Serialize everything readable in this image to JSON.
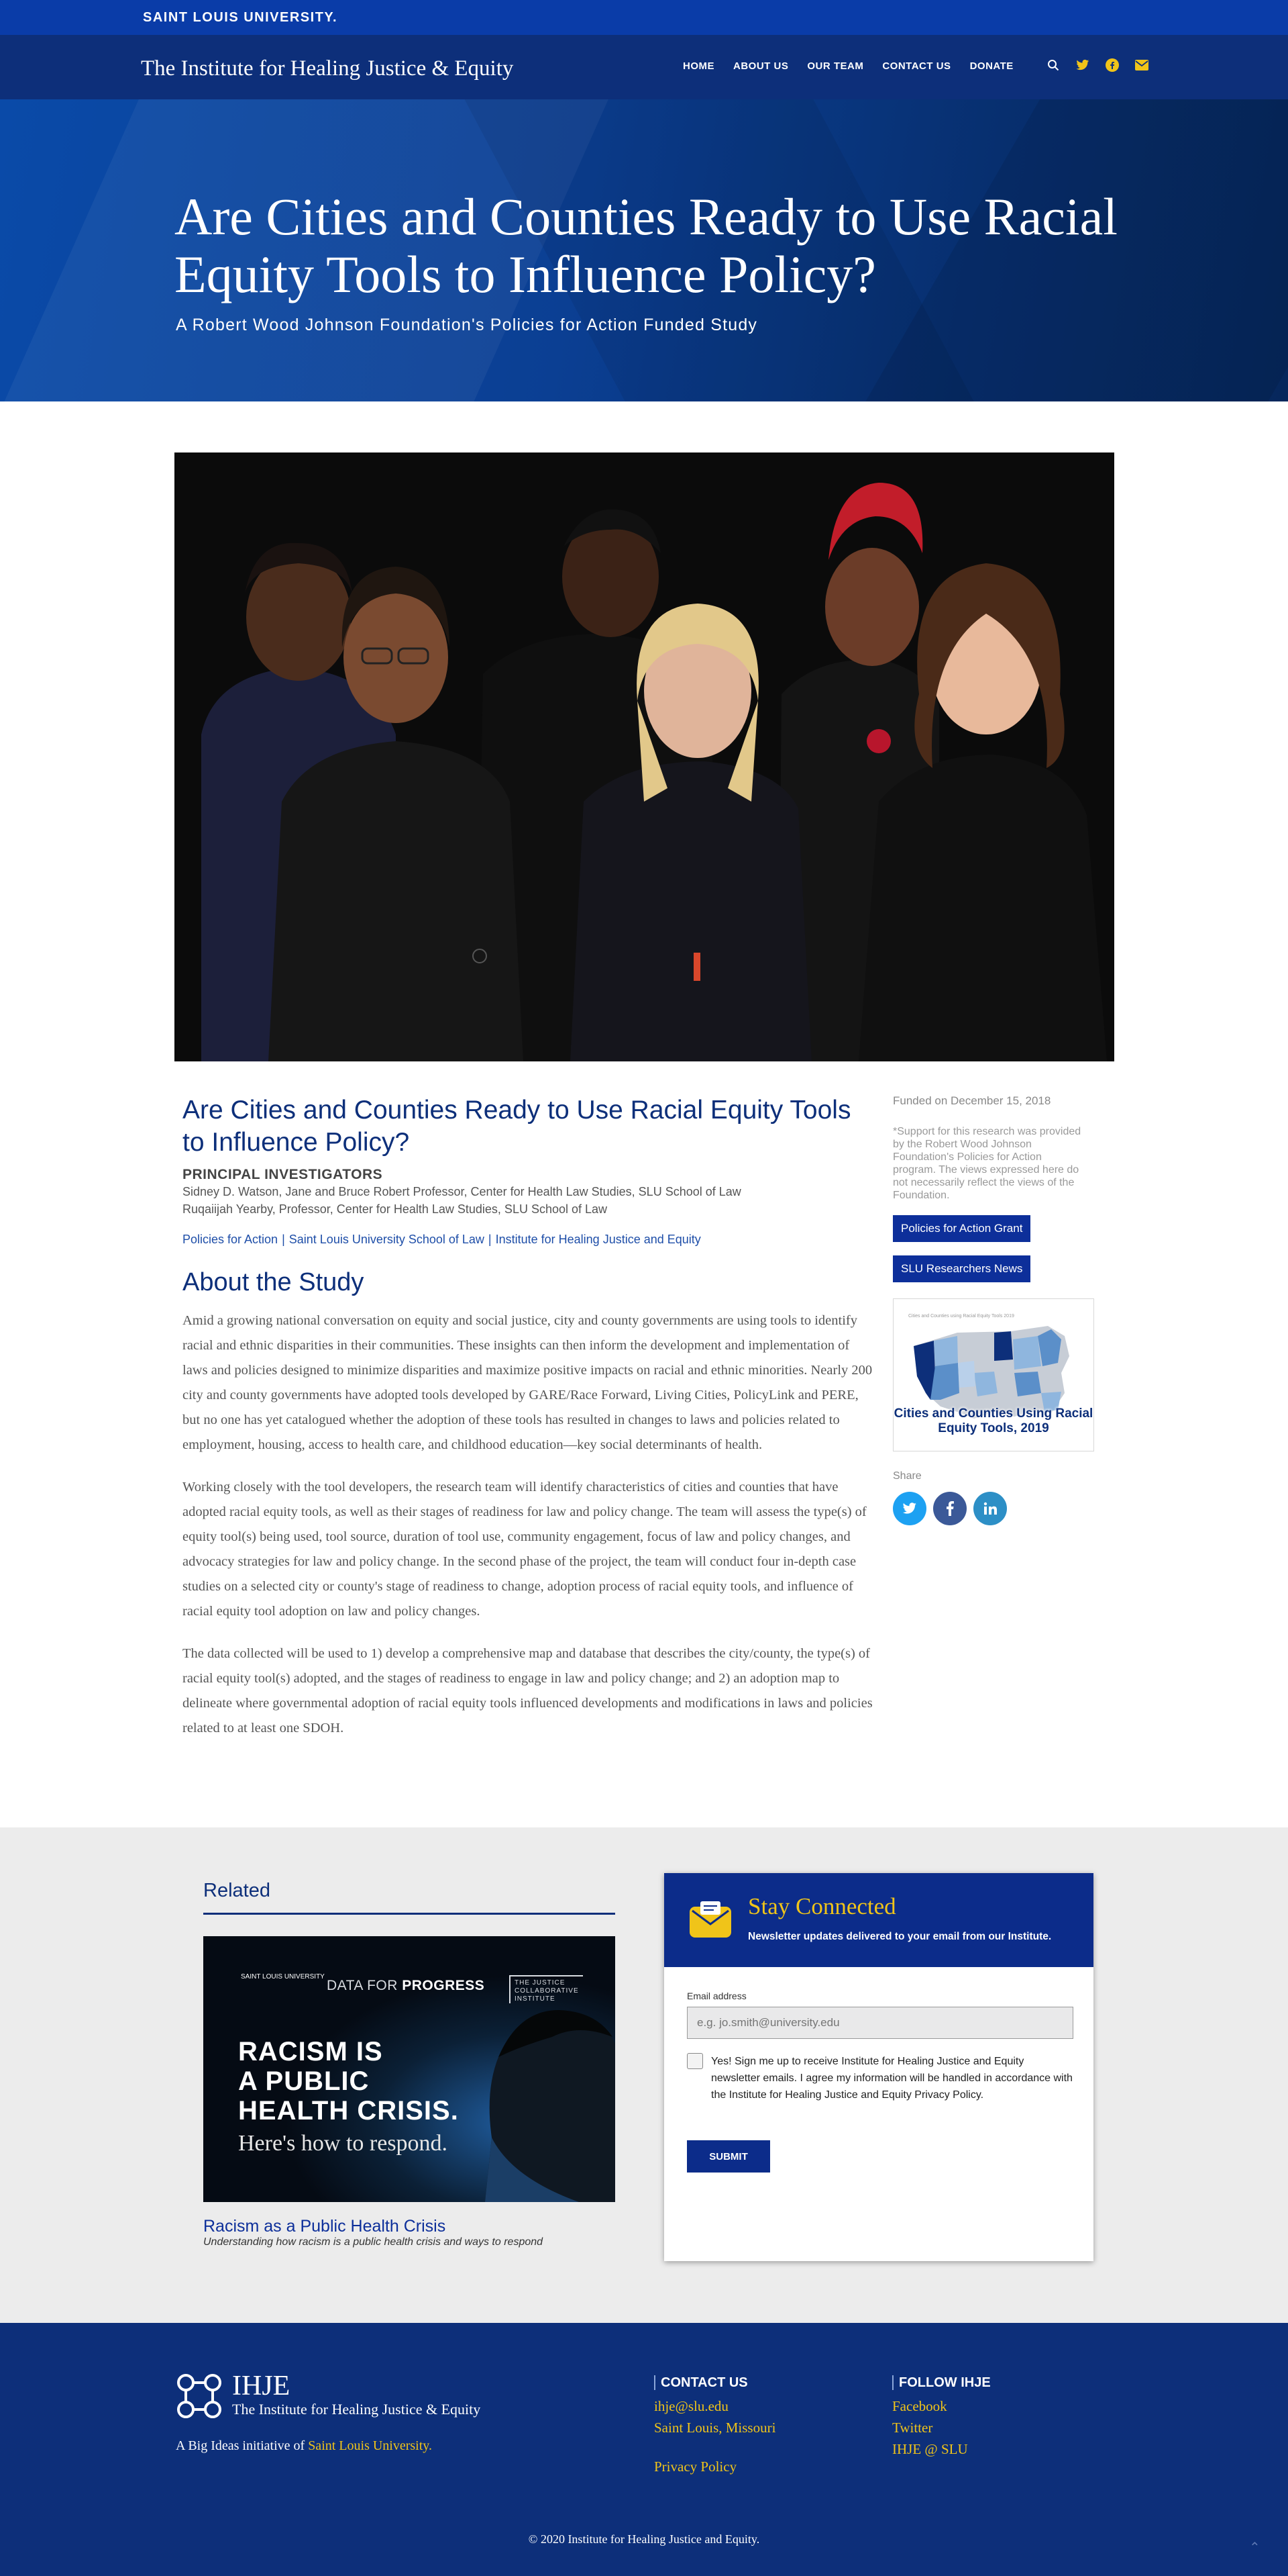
{
  "top_bar": {
    "university_name": "SAINT LOUIS UNIVERSITY."
  },
  "header": {
    "site_title": "The Institute for Healing Justice & Equity",
    "nav": [
      "HOME",
      "ABOUT US",
      "OUR TEAM",
      "CONTACT US",
      "DONATE"
    ],
    "icons": [
      "search-icon",
      "twitter-icon",
      "facebook-icon",
      "email-icon"
    ]
  },
  "hero": {
    "title": "Are Cities and Counties Ready to Use Racial Equity Tools to Influence Policy?",
    "subtitle": "A Robert Wood Johnson Foundation's Policies for Action Funded Study"
  },
  "article": {
    "title": "Are Cities and Counties Ready to Use Racial Equity Tools to Influence Policy?",
    "pi_heading": "PRINCIPAL INVESTIGATORS",
    "investigators": [
      "Sidney D. Watson, Jane and Bruce Robert Professor, Center for Health Law Studies, SLU School of Law",
      "Ruqaiijah Yearby, Professor, Center for Health Law Studies, SLU School of Law"
    ],
    "tags": [
      "Policies for Action",
      "Saint Louis University School of Law",
      "Institute for Healing Justice and Equity"
    ],
    "tag_separator": "|",
    "section_heading": "About the Study",
    "paragraphs": [
      "Amid a growing national conversation on equity and social justice, city and county governments are using tools to identify racial and ethnic disparities in their communities. These insights can then inform the development and implementation of laws and policies designed to minimize disparities and maximize positive impacts on racial and ethnic minorities. Nearly 200 city and county governments have adopted tools developed by GARE/Race Forward, Living Cities, PolicyLink and PERE, but no one has yet catalogued whether the adoption of these tools has resulted in changes to laws and policies related to employment, housing, access to health care, and childhood education—key social determinants of health.",
      "Working closely with the tool developers, the research team will identify characteristics of cities and counties that have adopted racial equity tools, as well as their stages of readiness for law and policy change. The team will assess the type(s) of equity tool(s) being used, tool source, duration of tool use, community engagement, focus of law and policy changes, and advocacy strategies for law and policy change. In the second phase of the project, the team will conduct four in-depth case studies on a selected city or county's stage of readiness to change, adoption process of racial equity tools, and influence of racial equity tool adoption on law and policy changes.",
      "The data collected will be used to 1) develop a comprehensive map and database that describes the city/county, the type(s) of racial equity tool(s) adopted, and the stages of readiness to engage in law and policy change; and 2) an adoption map to delineate where governmental adoption of racial equity tools influenced developments and modifications in laws and policies related to at least one SDOH."
    ]
  },
  "sidebar": {
    "funded": "Funded on December 15, 2018",
    "support_note": "*Support for this research was provided by the Robert Wood Johnson Foundation's Policies for Action program. The views expressed here do not necessarily reflect the views of the Foundation.",
    "buttons": [
      "Policies for Action Grant",
      "SLU Researchers News"
    ],
    "map_small_title": "Cities and Counties using Racial Equity Tools 2019",
    "map_caption": "Cities and Counties Using Racial Equity Tools, 2019",
    "share_label": "Share",
    "share_icons": [
      "twitter-icon",
      "facebook-icon",
      "linkedin-icon"
    ],
    "share_colors": [
      "#1da1f2",
      "#3b5998",
      "#2d8fc6"
    ]
  },
  "related": {
    "heading": "Related",
    "image_top_left": "SAINT LOUIS UNIVERSITY",
    "image_data_prefix": "DATA FOR",
    "image_data_emph": "PROGRESS",
    "image_collab": "THE JUSTICE COLLABORATIVE INSTITUTE",
    "image_headline": [
      "RACISM IS",
      "A PUBLIC",
      "HEALTH CRISIS."
    ],
    "image_subline": "Here's how to respond.",
    "title": "Racism as a Public Health Crisis",
    "description": "Understanding how racism is a public health crisis and ways to respond"
  },
  "newsletter": {
    "title": "Stay Connected",
    "subtitle": "Newsletter updates delivered to your email from our Institute.",
    "email_label": "Email address",
    "email_placeholder": "e.g. jo.smith@university.edu",
    "consent": "Yes! Sign me up to receive Institute for Healing Justice and Equity newsletter emails. I agree my information will be handled in accordance with the Institute for Healing Justice and Equity Privacy Policy.",
    "submit": "SUBMIT"
  },
  "footer": {
    "brand_short": "IHJE",
    "brand_full": "The Institute for Healing Justice & Equity",
    "big_ideas_prefix": "A Big Ideas initiative of",
    "big_ideas_link": "Saint Louis University.",
    "contact_heading": "CONTACT US",
    "contact_links": [
      "ihje@slu.edu",
      "Saint Louis, Missouri"
    ],
    "privacy": "Privacy Policy",
    "follow_heading": "FOLLOW IHJE",
    "follow_links": [
      "Facebook",
      "Twitter",
      "IHJE @ SLU"
    ],
    "copyright": "© 2020 Institute for Healing Justice and Equity.",
    "accent_color": "#f0c419",
    "brand_color": "#0d2f7a"
  }
}
